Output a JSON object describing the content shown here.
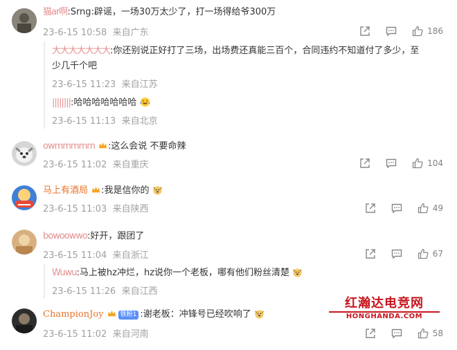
{
  "comments": [
    {
      "username": "猫ar啊",
      "text": ":Srng:辟谣，一场30万太少了，打一场得给爷300万",
      "time": "23-6-15 10:58",
      "location": "来自广东",
      "likes": "186",
      "avatar_color": "#6e6a60",
      "replies": [
        {
          "username": "大大大大大大大",
          "text": ":你还别说正好打了三场，出场费还真能三百个，合同违约不知道付了多少，至",
          "text2": "少几千个吧",
          "time": "23-6-15 11:23",
          "location": "来自江苏"
        },
        {
          "username": "||||||||",
          "text": ":哈哈哈哈哈哈哈",
          "time": "23-6-15 11:13",
          "location": "来自北京"
        }
      ]
    },
    {
      "username": "owmmmmm",
      "text": ":这么会说 不要命辣",
      "time": "23-6-15 11:02",
      "location": "来自重庆",
      "likes": "104",
      "avatar_color": "#bdbdbd"
    },
    {
      "username": "马上有酒局",
      "text": ":我是信你的",
      "time": "23-6-15 11:03",
      "location": "来自陕西",
      "likes": "49",
      "avatar_color": "#3f7fd6"
    },
    {
      "username": "bowoowwo",
      "text": ":好开，跟团了",
      "time": "23-6-15 11:04",
      "location": "来自浙江",
      "likes": "67",
      "avatar_color": "#d8b080",
      "replies": [
        {
          "username": "Wuwu",
          "text": ":马上被hz冲烂，hz说你一个老板，哪有他们粉丝清楚",
          "time": "23-6-15 11:26",
          "location": "来自江西"
        }
      ]
    },
    {
      "username": "ChampionJoy",
      "fan_badge": "铁粉1",
      "text": ":谢老板：冲锋号已经吹响了",
      "time": "23-6-15 11:02",
      "location": "来自河南",
      "likes": "58",
      "avatar_color": "#2d2d2d"
    }
  ],
  "icons": {
    "share": "share-icon",
    "comment": "comment-icon",
    "like": "like-icon"
  },
  "watermark": {
    "cn": "红瀚达电竞网",
    "en": "HONGHANDA.COM"
  }
}
